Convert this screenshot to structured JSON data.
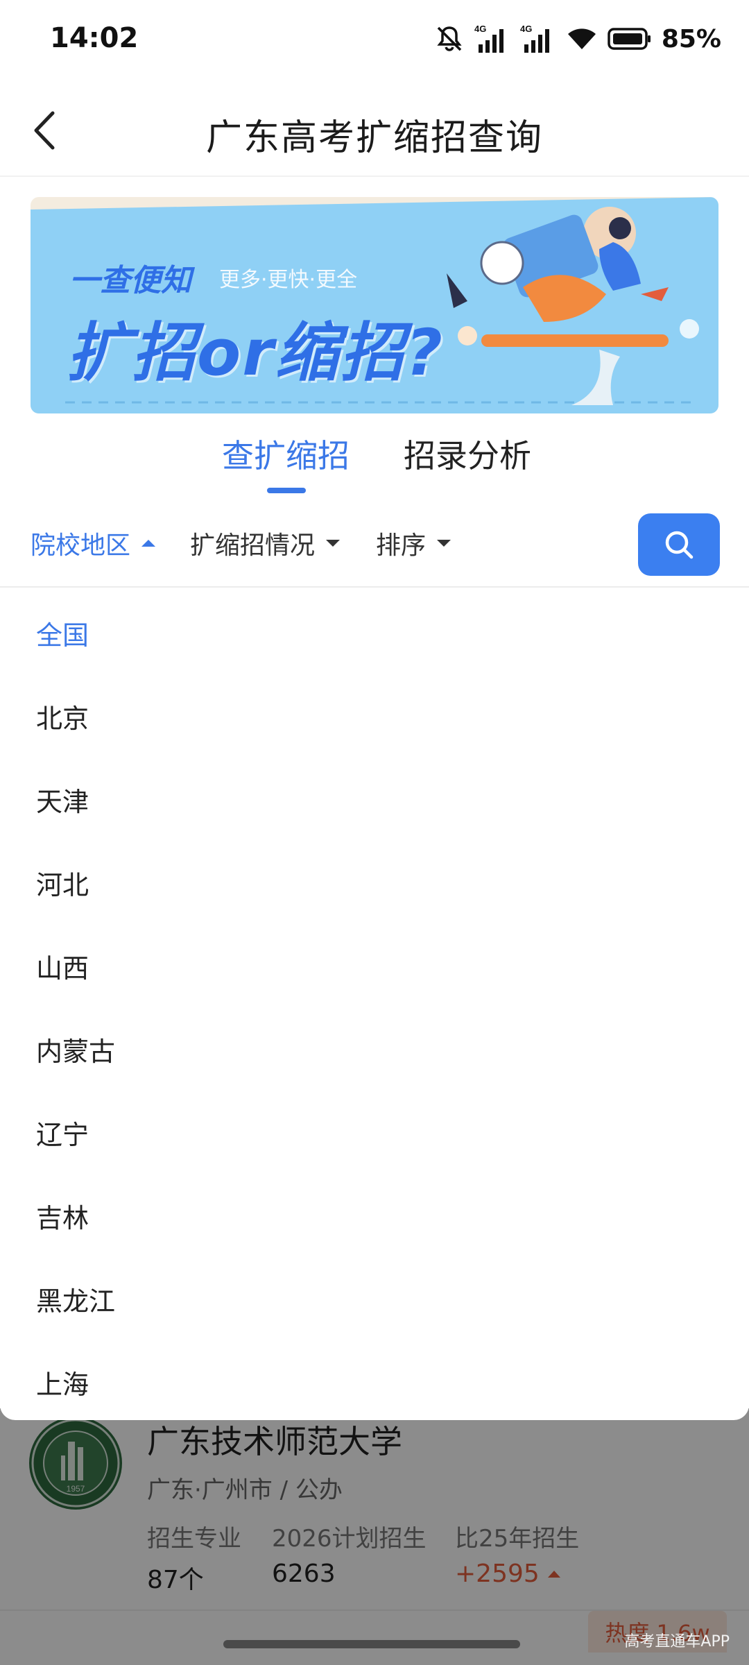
{
  "status_bar": {
    "time": "14:02",
    "battery": "85%",
    "network_label": "4G",
    "icons": [
      "mute-icon",
      "signal-icon",
      "signal-icon",
      "wifi-icon",
      "battery-icon"
    ]
  },
  "nav": {
    "title": "广东高考扩缩招查询",
    "back_icon": "chevron-left-icon"
  },
  "banner": {
    "slogan": "一查便知",
    "sub": "更多·更快·更全",
    "headline": "扩招or缩招?"
  },
  "tabs": [
    {
      "label": "查扩缩招",
      "active": true
    },
    {
      "label": "招录分析",
      "active": false
    }
  ],
  "filters": [
    {
      "label": "院校地区",
      "active": true,
      "icon": "caret-up-icon"
    },
    {
      "label": "扩缩招情况",
      "active": false,
      "icon": "caret-down-icon"
    },
    {
      "label": "排序",
      "active": false,
      "icon": "caret-down-icon"
    }
  ],
  "search_icon": "search-icon",
  "regions": [
    "全国",
    "北京",
    "天津",
    "河北",
    "山西",
    "内蒙古",
    "辽宁",
    "吉林",
    "黑龙江",
    "上海"
  ],
  "selected_region": "全国",
  "university": {
    "name": "广东技术师范大学",
    "location": "广东·广州市 / 公办",
    "logo_year": "1957",
    "stats": [
      {
        "label": "招生专业",
        "value": "87个"
      },
      {
        "label": "2026计划招生",
        "value": "6263"
      },
      {
        "label": "比25年招生",
        "value": "+2595"
      }
    ],
    "hot_label": "热度 1.6w"
  },
  "watermark": "高考直通车APP",
  "colors": {
    "accent": "#3b78e7",
    "search_button": "#3b7ff0",
    "increase": "#e35d3c",
    "banner_bg": "#8fd0f5"
  }
}
